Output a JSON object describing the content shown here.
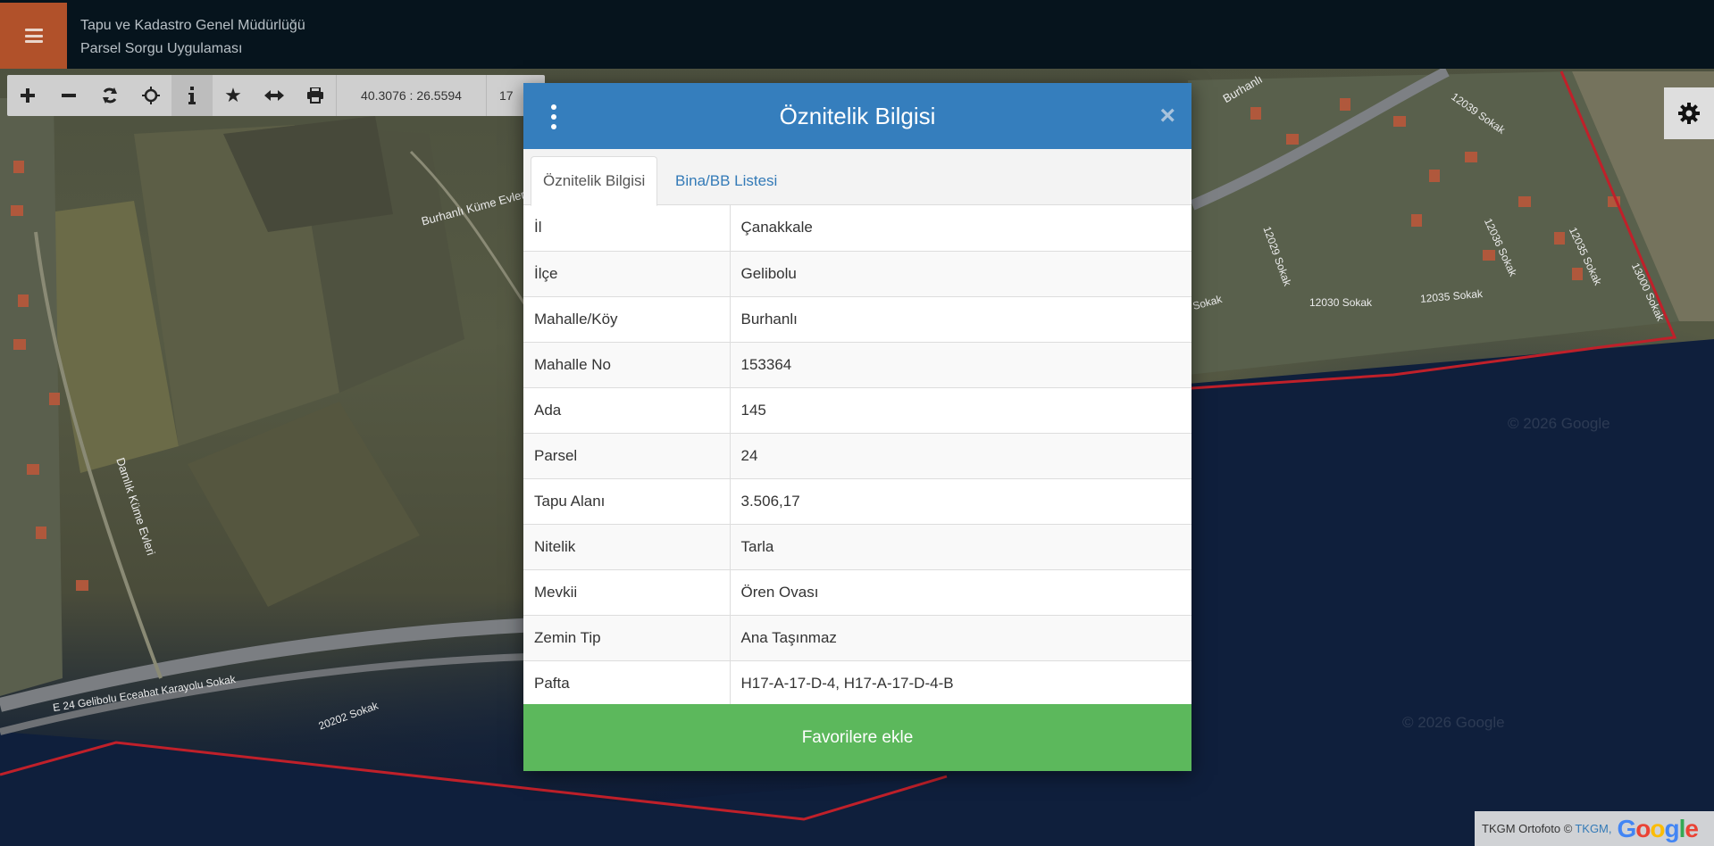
{
  "header": {
    "org_title": "Tapu ve Kadastro Genel Müdürlüğü",
    "app_title": "Parsel Sorgu Uygulaması"
  },
  "toolbar": {
    "buttons": [
      {
        "name": "zoom-in",
        "icon": "+"
      },
      {
        "name": "zoom-out",
        "icon": "−"
      },
      {
        "name": "refresh",
        "icon": "refresh"
      },
      {
        "name": "locate",
        "icon": "crosshair"
      },
      {
        "name": "info",
        "icon": "i"
      },
      {
        "name": "favorites",
        "icon": "★"
      },
      {
        "name": "measure",
        "icon": "↔"
      },
      {
        "name": "print",
        "icon": "printer"
      }
    ],
    "coordinates": "40.3076 : 26.5594",
    "coordinates_extra": "17"
  },
  "modal": {
    "title": "Öznitelik Bilgisi",
    "tabs": [
      {
        "label": "Öznitelik Bilgisi",
        "active": true
      },
      {
        "label": "Bina/BB Listesi",
        "active": false
      }
    ],
    "rows": [
      {
        "key": "İl",
        "value": "Çanakkale"
      },
      {
        "key": "İlçe",
        "value": "Gelibolu"
      },
      {
        "key": "Mahalle/Köy",
        "value": "Burhanlı"
      },
      {
        "key": "Mahalle No",
        "value": "153364"
      },
      {
        "key": "Ada",
        "value": "145"
      },
      {
        "key": "Parsel",
        "value": "24"
      },
      {
        "key": "Tapu Alanı",
        "value": "3.506,17"
      },
      {
        "key": "Nitelik",
        "value": "Tarla"
      },
      {
        "key": "Mevkii",
        "value": "Ören Ovası"
      },
      {
        "key": "Zemin Tip",
        "value": "Ana Taşınmaz"
      },
      {
        "key": "Pafta",
        "value": "H17-A-17-D-4, H17-A-17-D-4-B"
      }
    ],
    "favorite_button": "Favorilere ekle"
  },
  "map_labels": {
    "road_1": "Burhanlı Küme Evleri",
    "road_2": "Damlık Küme Evleri",
    "road_3": "E 24 Gelibolu Eceabat Karayolu Sokak",
    "road_4": "20202 Sokak",
    "street_1": "12039 Sokak",
    "street_2": "12030 Sokak",
    "street_3": "12035 Sokak",
    "street_4": "12029 Sokak",
    "street_5": "12036 Sokak",
    "street_6": "12035 Sokak",
    "street_7": "13000 Sokak",
    "street_8": "Sokak",
    "street_9": "Burhanlı",
    "watermark_1": "© 2026 Google",
    "watermark_2": "© 2026 Google"
  },
  "attribution": {
    "text": "TKGM Ortofoto ©",
    "link": "TKGM,",
    "logo": "Google"
  },
  "colors": {
    "header_bg": "#06141d",
    "menu_accent": "#b1512a",
    "modal_header": "#357ebd",
    "favorite_button": "#5cb85c",
    "parcel_outline": "#c0202a"
  }
}
